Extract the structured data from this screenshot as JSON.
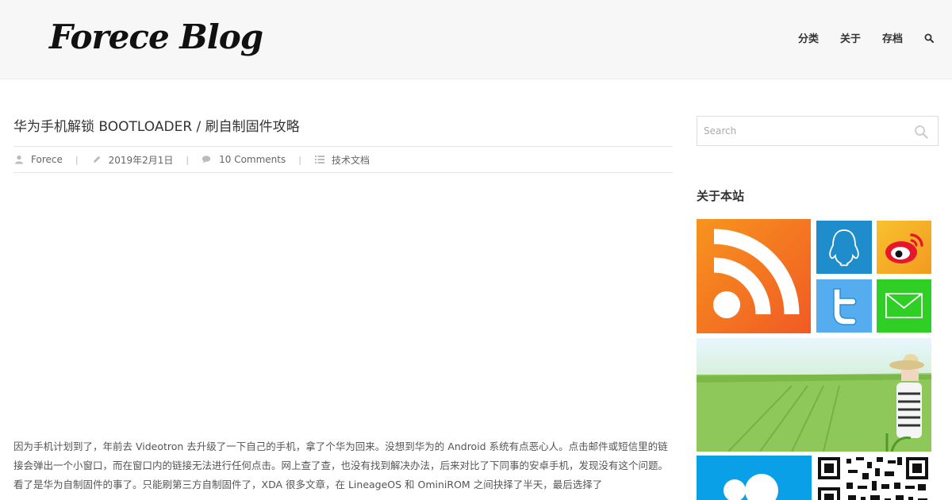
{
  "site": {
    "title": "Forece Blog"
  },
  "nav": {
    "items": [
      "分类",
      "关于",
      "存档"
    ]
  },
  "post": {
    "title": "华为手机解锁 BOOTLOADER / 刷自制固件攻略",
    "author": "Forece",
    "date": "2019年2月1日",
    "comments": "10 Comments",
    "category": "技术文档",
    "body": "因为手机计划到了，年前去 Videotron 去升级了一下自己的手机，拿了个华为回来。没想到华为的 Android 系统有点恶心人。点击邮件或短信里的链接会弹出一个小窗口，而在窗口内的链接无法进行任何点击。网上查了查，也没有找到解决办法，后来对比了下同事的安卓手机，发现没有这个问题。看了是华为自制固件的事了。只能刷第三方自制固件了，XDA 很多文章，在 LineageOS 和 OminiROM 之间抉择了半天，最后选择了"
  },
  "sidebar": {
    "search_placeholder": "Search",
    "about_title": "关于本站"
  },
  "colors": {
    "rss": "#f7941e",
    "qq": "#1f8ccb",
    "weibo": "#f8c22e",
    "twitter": "#55acee",
    "mail": "#2fcf25",
    "blue_tile": "#0aa0e8"
  },
  "icons": [
    "search-icon",
    "user-icon",
    "pencil-icon",
    "comments-icon",
    "list-icon",
    "rss-icon",
    "qq-penguin-icon",
    "weibo-icon",
    "twitter-icon",
    "mail-icon",
    "qr-code-icon"
  ]
}
